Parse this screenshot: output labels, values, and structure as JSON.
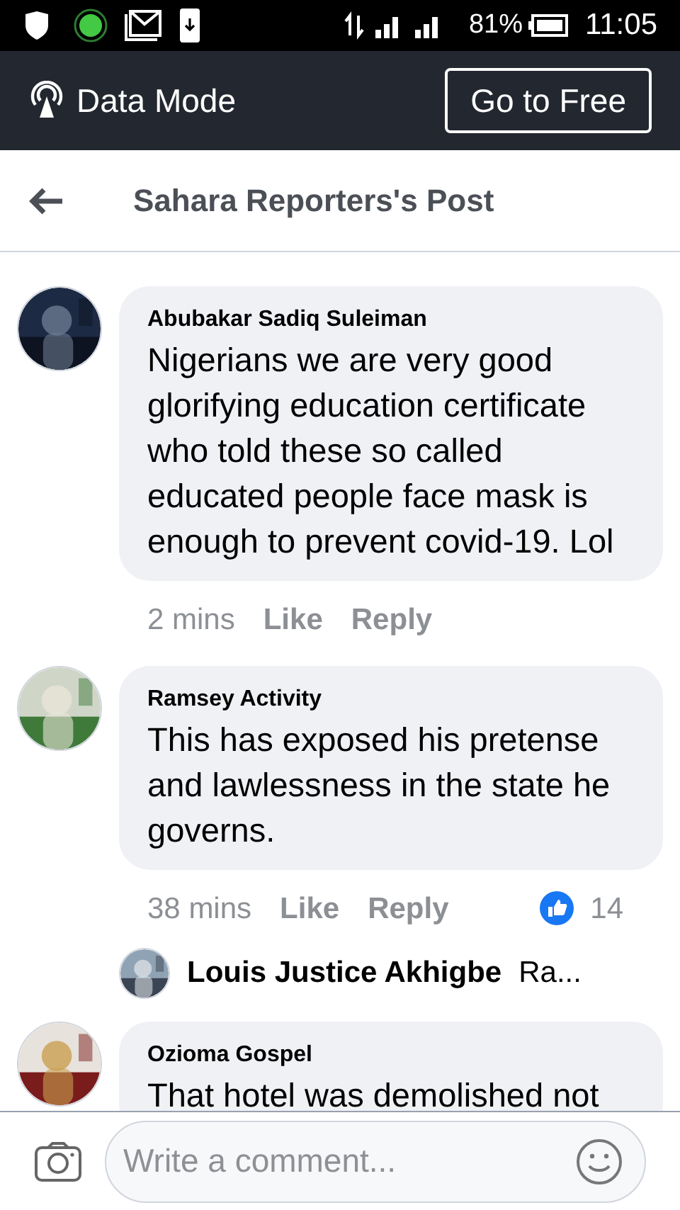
{
  "status_bar": {
    "battery": "81%",
    "time": "11:05"
  },
  "data_bar": {
    "label": "Data Mode",
    "button": "Go to Free"
  },
  "header": {
    "title": "Sahara Reporters's Post"
  },
  "comments": [
    {
      "author": "Abubakar Sadiq Suleiman",
      "text": "Nigerians we are very good glorifying education certificate who told these so called educated people face mask is enough to prevent covid-19. Lol",
      "time": "2 mins",
      "like": "Like",
      "reply": "Reply"
    },
    {
      "author": "Ramsey Activity",
      "text": "This has exposed his pretense and lawlessness in the state he governs.",
      "time": "38 mins",
      "like": "Like",
      "reply": "Reply",
      "reactions": "14",
      "replies": [
        {
          "author": "Louis Justice Akhigbe",
          "text": "Ra..."
        }
      ]
    },
    {
      "author": "Ozioma Gospel",
      "text": "That hotel was demolished not"
    }
  ],
  "composer": {
    "placeholder": "Write a comment..."
  }
}
